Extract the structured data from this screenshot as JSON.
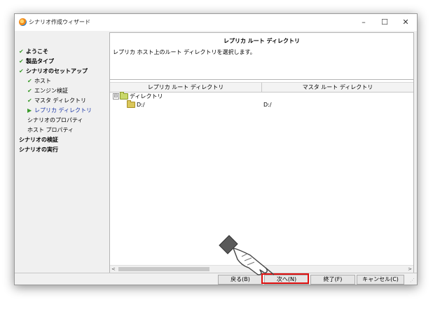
{
  "window": {
    "title": "シナリオ作成ウィザード",
    "minimize": "–",
    "maximize": "☐",
    "close": "✕"
  },
  "sidebar": {
    "items": [
      {
        "label": "ようこそ",
        "state": "done"
      },
      {
        "label": "製品タイプ",
        "state": "done"
      },
      {
        "label": "シナリオのセットアップ",
        "state": "done"
      },
      {
        "label": "ホスト",
        "state": "done"
      },
      {
        "label": "エンジン検証",
        "state": "done"
      },
      {
        "label": "マスタ ディレクトリ",
        "state": "done"
      },
      {
        "label": "レプリカ ディレクトリ",
        "state": "current"
      },
      {
        "label": "シナリオのプロパティ",
        "state": "pending"
      },
      {
        "label": "ホスト プロパティ",
        "state": "pending"
      },
      {
        "label": "シナリオの検証",
        "state": "pending"
      },
      {
        "label": "シナリオの実行",
        "state": "pending"
      }
    ],
    "check_glyph": "✔",
    "arrow_glyph": "▶"
  },
  "panel": {
    "title": "レプリカ ルート ディレクトリ",
    "description": "レプリカ ホスト上のルート ディレクトリを選択します。",
    "columns": [
      "レプリカ ルート ディレクトリ",
      "マスタ ルート ディレクトリ"
    ],
    "tree": {
      "expander": "⊟",
      "root_label": "ディレクトリ",
      "rows": [
        {
          "replica": "D:/",
          "master": "D:/"
        }
      ]
    },
    "scroll_left": "<",
    "scroll_right": ">"
  },
  "buttons": {
    "back": "戻る(B)",
    "next": "次へ(N)",
    "finish": "終了(F)",
    "cancel": "キャンセル(C)"
  },
  "icons": {
    "app": "app-icon",
    "folder": "folder-icon",
    "pointer": "hand-pointer-icon"
  },
  "colors": {
    "check": "#3a9a2a",
    "active_nav": "#1c38a8",
    "highlight": "#e01010"
  }
}
